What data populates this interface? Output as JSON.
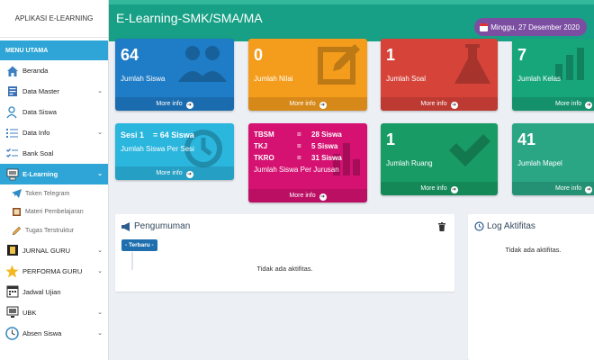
{
  "app": {
    "brand": "APLIKASI E-LEARNING"
  },
  "sidebar": {
    "header": "MENU UTAMA",
    "items": [
      {
        "label": "Beranda",
        "icon": "home-icon"
      },
      {
        "label": "Data Master",
        "icon": "database-icon"
      },
      {
        "label": "Data Siswa",
        "icon": "users-icon"
      },
      {
        "label": "Data Info",
        "icon": "list-icon"
      },
      {
        "label": "Bank Soal",
        "icon": "checklist-icon"
      },
      {
        "label": "E-Learning",
        "icon": "computer-icon"
      }
    ],
    "subitems": [
      {
        "label": "Token Telegram",
        "icon": "telegram-icon"
      },
      {
        "label": "Materi Pembelajaran",
        "icon": "book-icon"
      },
      {
        "label": "Tugas Terstruktur",
        "icon": "pencil-icon"
      }
    ],
    "items2": [
      {
        "label": "JURNAL GURU",
        "icon": "film-icon"
      },
      {
        "label": "PERFORMA GURU",
        "icon": "star-icon"
      },
      {
        "label": "Jadwal Ujian",
        "icon": "calendar-icon"
      },
      {
        "label": "UBK",
        "icon": "monitor-icon"
      },
      {
        "label": "Absen Siswa",
        "icon": "clock-icon"
      }
    ]
  },
  "header": {
    "title": "E-Learning-SMK/SMA/MA",
    "date": "Minggu, 27 Desember 2020"
  },
  "stats": {
    "siswa": {
      "value": "64",
      "label": "Jumlah Siswa",
      "more": "More info"
    },
    "nilai": {
      "value": "0",
      "label": "Jumlah Nilai",
      "more": "More info"
    },
    "soal": {
      "value": "1",
      "label": "Jumlah Soal",
      "more": "More info"
    },
    "kelas": {
      "value": "7",
      "label": "Jumlah Kelas",
      "more": "More info"
    },
    "sesi": {
      "title": "Sesi 1    = 64 Siswa",
      "label": "Jumlah Siswa Per Sesi",
      "more": "More info"
    },
    "jurusan": {
      "rows": [
        {
          "k": "TBSM",
          "eq": "=",
          "v": "28 Siswa"
        },
        {
          "k": "TKJ",
          "eq": "=",
          "v": "5 Siswa"
        },
        {
          "k": "TKRO",
          "eq": "=",
          "v": "31 Siswa"
        }
      ],
      "label": "Jumlah Siswa Per Jurusan",
      "more": "More info"
    },
    "ruang": {
      "value": "1",
      "label": "Jumlah Ruang",
      "more": "More info"
    },
    "mapel": {
      "value": "41",
      "label": "Jumlah Mapel",
      "more": "More info"
    }
  },
  "pengumuman": {
    "title": "Pengumuman",
    "badge": "- Terbaru -",
    "empty": "Tidak ada aktifitas."
  },
  "log": {
    "title": "Log Aktifitas",
    "empty": "Tidak ada aktifitas."
  },
  "colors": {
    "sidebar_active": "#2ea5d6",
    "topbar": "#17a085",
    "date_badge": "#7b4ea2"
  }
}
